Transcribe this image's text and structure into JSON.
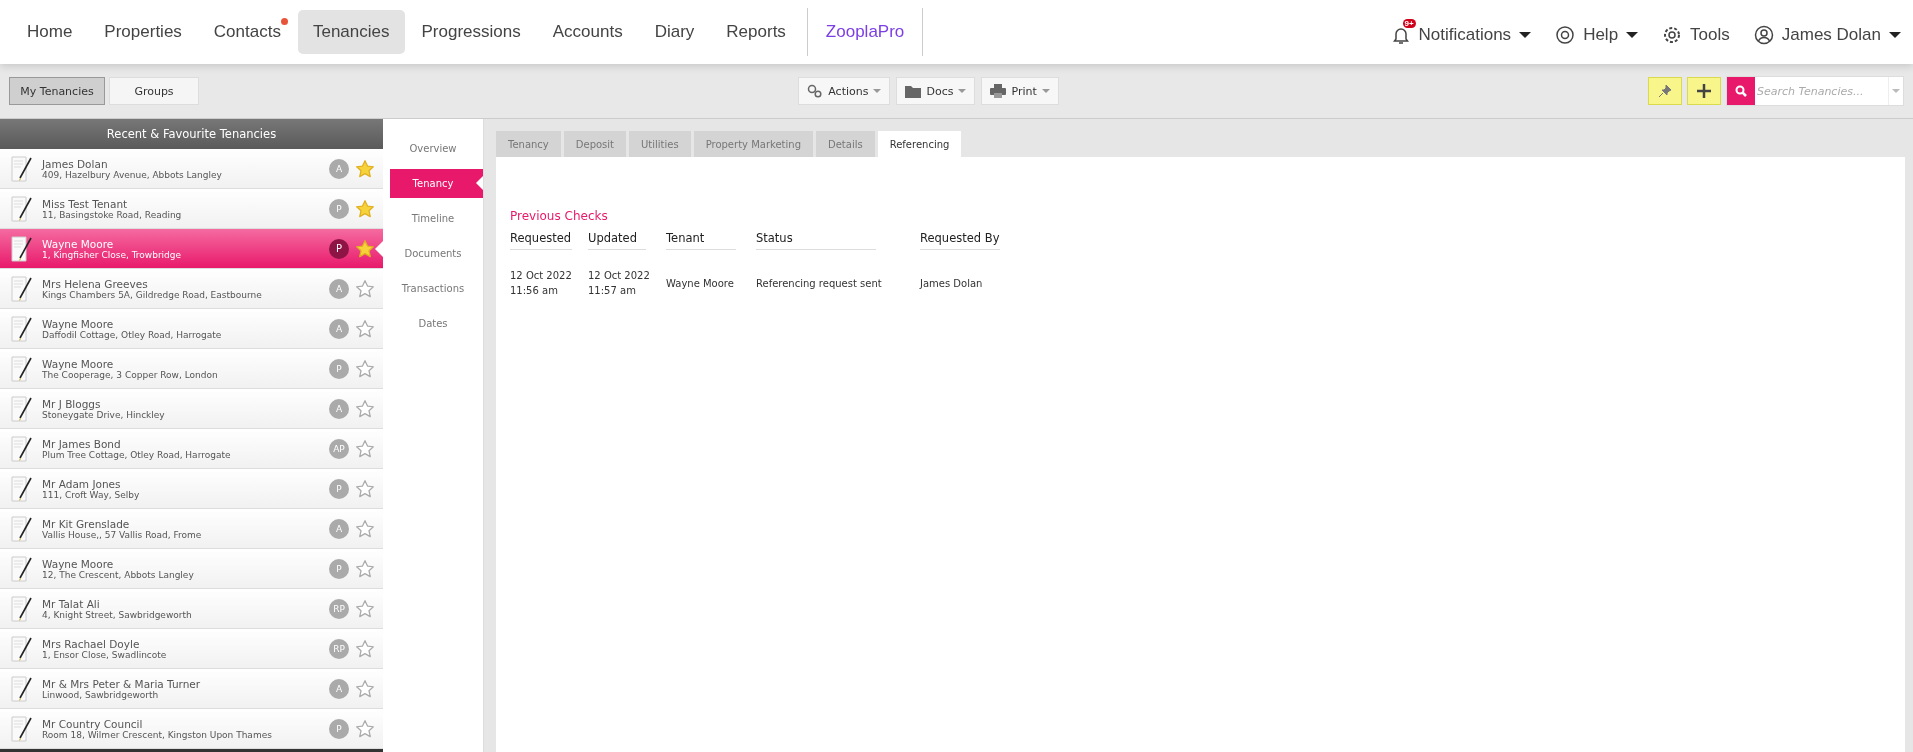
{
  "nav": {
    "items": [
      {
        "label": "Home",
        "selected": false,
        "dot": false,
        "kind": "page"
      },
      {
        "label": "Properties",
        "selected": false,
        "dot": false,
        "kind": "page"
      },
      {
        "label": "Contacts",
        "selected": false,
        "dot": true,
        "kind": "page"
      },
      {
        "label": "Tenancies",
        "selected": true,
        "dot": false,
        "kind": "page"
      },
      {
        "label": "Progressions",
        "selected": false,
        "dot": false,
        "kind": "page"
      },
      {
        "label": "Accounts",
        "selected": false,
        "dot": false,
        "kind": "page"
      },
      {
        "label": "Diary",
        "selected": false,
        "dot": false,
        "kind": "page"
      },
      {
        "label": "Reports",
        "selected": false,
        "dot": false,
        "kind": "page"
      },
      {
        "label": "ZooplaPro",
        "selected": false,
        "dot": false,
        "kind": "external"
      }
    ],
    "right": {
      "notifications": {
        "label": "Notifications",
        "badge": "9+"
      },
      "help": "Help",
      "tools": "Tools",
      "user": "James Dolan"
    }
  },
  "toolbar": {
    "views": [
      {
        "label": "My Tenancies",
        "selected": true
      },
      {
        "label": "Groups",
        "selected": false
      }
    ],
    "actions": [
      "Actions",
      "Docs",
      "Print"
    ],
    "search": {
      "placeholder": "Search Tenancies..."
    }
  },
  "sidebar": {
    "title": "Recent & Favourite Tenancies",
    "items": [
      {
        "name": "James Dolan",
        "address": "409, Hazelbury Avenue, Abbots Langley",
        "badge": "A",
        "favourite": true,
        "selected": false
      },
      {
        "name": "Miss Test Tenant",
        "address": "11, Basingstoke Road, Reading",
        "badge": "P",
        "favourite": true,
        "selected": false
      },
      {
        "name": "Wayne Moore",
        "address": "1, Kingfisher Close, Trowbridge",
        "badge": "P",
        "favourite": true,
        "selected": true
      },
      {
        "name": "Mrs Helena Greeves",
        "address": "Kings Chambers 5A, Gildredge Road, Eastbourne",
        "badge": "A",
        "favourite": false,
        "selected": false
      },
      {
        "name": "Wayne Moore",
        "address": "Daffodil Cottage, Otley Road, Harrogate",
        "badge": "A",
        "favourite": false,
        "selected": false
      },
      {
        "name": "Wayne Moore",
        "address": "The Cooperage, 3 Copper Row, London",
        "badge": "P",
        "favourite": false,
        "selected": false
      },
      {
        "name": "Mr J Bloggs",
        "address": "Stoneygate Drive, Hinckley",
        "badge": "A",
        "favourite": false,
        "selected": false
      },
      {
        "name": "Mr James Bond",
        "address": "Plum Tree Cottage, Otley Road, Harrogate",
        "badge": "AP",
        "favourite": false,
        "selected": false
      },
      {
        "name": "Mr Adam Jones",
        "address": "111, Croft Way, Selby",
        "badge": "P",
        "favourite": false,
        "selected": false
      },
      {
        "name": "Mr Kit Grenslade",
        "address": "Vallis House,, 57 Vallis Road, Frome",
        "badge": "A",
        "favourite": false,
        "selected": false
      },
      {
        "name": "Wayne Moore",
        "address": "12, The Crescent, Abbots Langley",
        "badge": "P",
        "favourite": false,
        "selected": false
      },
      {
        "name": "Mr Talat Ali",
        "address": "4, Knight Street, Sawbridgeworth",
        "badge": "RP",
        "favourite": false,
        "selected": false
      },
      {
        "name": "Mrs Rachael Doyle",
        "address": "1, Ensor Close, Swadlincote",
        "badge": "RP",
        "favourite": false,
        "selected": false
      },
      {
        "name": "Mr & Mrs Peter & Maria Turner",
        "address": "Linwood, Sawbridgeworth",
        "badge": "A",
        "favourite": false,
        "selected": false
      },
      {
        "name": "Mr Country Council",
        "address": "Room 18, Wilmer Crescent, Kingston Upon Thames",
        "badge": "P",
        "favourite": false,
        "selected": false
      }
    ]
  },
  "subnav": [
    {
      "label": "Overview",
      "selected": false
    },
    {
      "label": "Tenancy",
      "selected": true
    },
    {
      "label": "Timeline",
      "selected": false
    },
    {
      "label": "Documents",
      "selected": false
    },
    {
      "label": "Transactions",
      "selected": false
    },
    {
      "label": "Dates",
      "selected": false
    }
  ],
  "tabs": [
    {
      "label": "Tenancy",
      "selected": false
    },
    {
      "label": "Deposit",
      "selected": false
    },
    {
      "label": "Utilities",
      "selected": false
    },
    {
      "label": "Property Marketing",
      "selected": false
    },
    {
      "label": "Details",
      "selected": false
    },
    {
      "label": "Referencing",
      "selected": true
    }
  ],
  "checks": {
    "title": "Previous Checks",
    "columns": [
      "Requested",
      "Updated",
      "Tenant",
      "Status",
      "Requested By"
    ],
    "rows": [
      [
        "12 Oct 2022\n11:56 am",
        "12 Oct 2022\n11:57 am",
        "Wayne Moore",
        "Referencing request sent",
        "James Dolan"
      ]
    ]
  }
}
